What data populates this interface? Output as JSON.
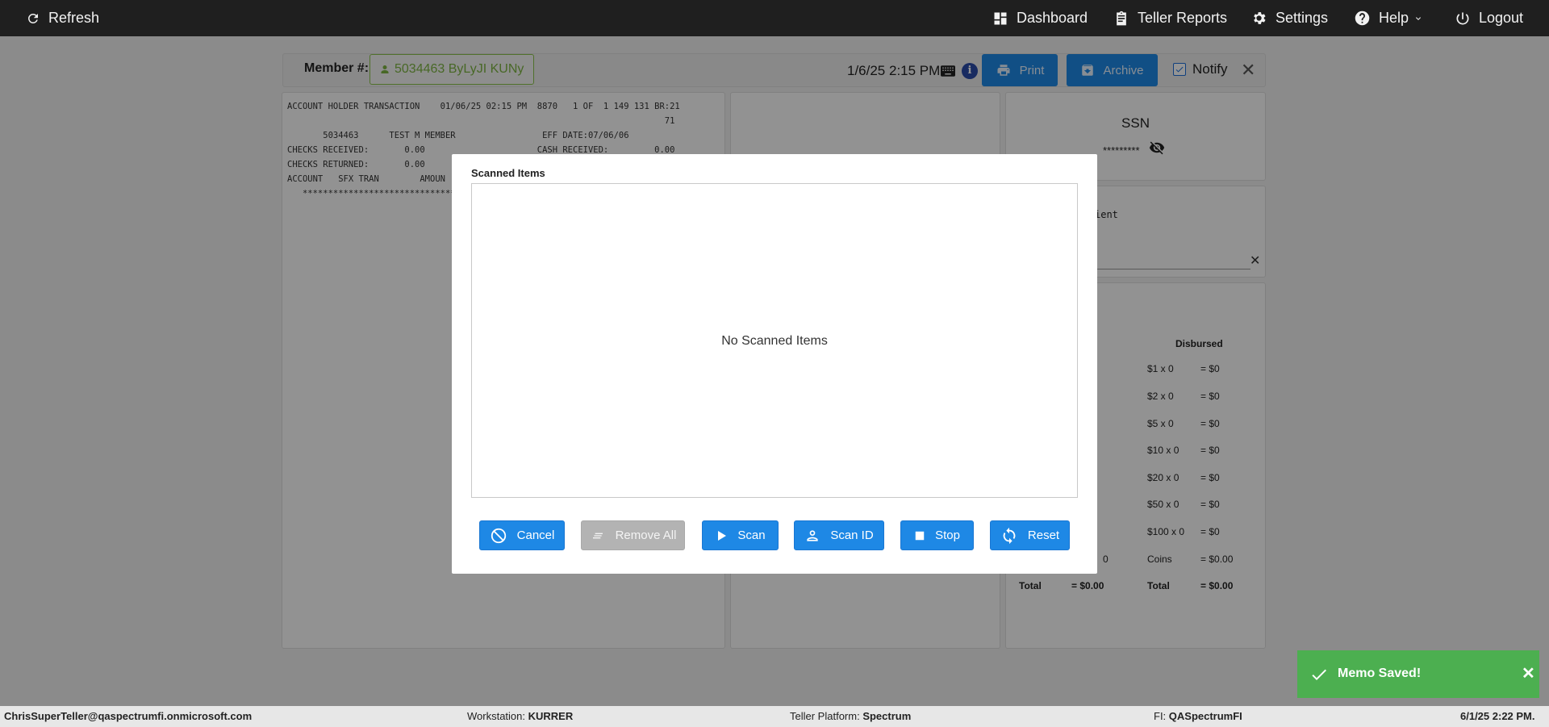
{
  "nav": {
    "refresh": "Refresh",
    "dashboard": "Dashboard",
    "teller_reports": "Teller Reports",
    "settings": "Settings",
    "help": "Help",
    "logout": "Logout"
  },
  "member": {
    "label": "Member #:",
    "chip": "5034463 ByLyJI KUNy",
    "datetime": "1/6/25 2:15 PM",
    "print": "Print",
    "archive": "Archive",
    "notify": "Notify",
    "notify_checked": true
  },
  "receipt": {
    "lines": [
      "ACCOUNT HOLDER TRANSACTION    01/06/25 02:15 PM  8870   1 OF  1 149 131 BR:21",
      "                                                                          71",
      "       5034463      TEST M MEMBER                 EFF DATE:07/06/06",
      "CHECKS RECEIVED:       0.00                      CASH RECEIVED:         0.00",
      "",
      "",
      "",
      "",
      "CHECKS RETURNED:       0.00",
      "",
      "ACCOUNT   SFX TRAN        AMOUN",
      "   ******************************"
    ]
  },
  "ssn": {
    "title": "SSN",
    "value": "*********"
  },
  "memo": {
    "text": "ient"
  },
  "cash": {
    "disbursed_header": "Disbursed",
    "rows": [
      {
        "denom": "$1 x 0",
        "val": "= $0"
      },
      {
        "denom": "$2 x 0",
        "val": "= $0"
      },
      {
        "denom": "$5 x 0",
        "val": "= $0"
      },
      {
        "denom": "$10 x 0",
        "val": "= $0"
      },
      {
        "denom": "$20 x 0",
        "val": "= $0"
      },
      {
        "denom": "$50 x 0",
        "val": "= $0"
      },
      {
        "denom": "$100 x 0",
        "val": "= $0"
      }
    ],
    "left_coins_tail": "0",
    "coins_label": "Coins",
    "coins_val": "= $0.00",
    "total_label_left": "Total",
    "total_val_left": "= $0.00",
    "total_label_right": "Total",
    "total_val_right": "= $0.00"
  },
  "modal": {
    "title": "Scanned Items",
    "empty": "No Scanned Items",
    "buttons": {
      "cancel": "Cancel",
      "remove_all": "Remove All",
      "scan": "Scan",
      "scan_id": "Scan ID",
      "stop": "Stop",
      "reset": "Reset"
    }
  },
  "footer": {
    "user": "ChrisSuperTeller@qaspectrumfi.onmicrosoft.com",
    "workstation_label": "Workstation: ",
    "workstation": "KURRER",
    "platform_label": "Teller Platform: ",
    "platform": "Spectrum",
    "fi_label": "FI: ",
    "fi": "QASpectrumFI",
    "datetime": "6/1/25 2:22 PM."
  },
  "toast": {
    "text": "Memo Saved!"
  }
}
